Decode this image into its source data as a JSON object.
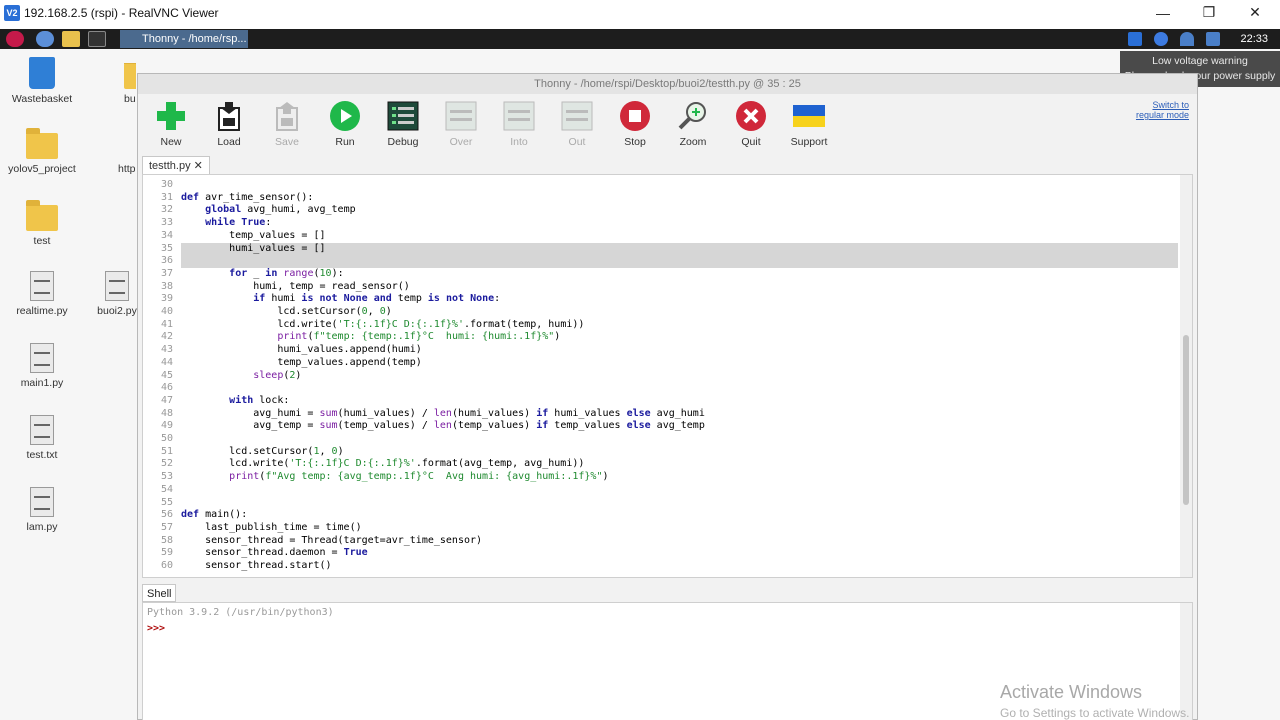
{
  "vnc": {
    "title": "192.168.2.5 (rspi) - RealVNC Viewer",
    "logo_text": "V2"
  },
  "taskbar": {
    "task_label": "Thonny - /home/rsp...",
    "clock": "22:33"
  },
  "warning": {
    "line1": "Low voltage warning",
    "line2": "Please check your power supply"
  },
  "desktop": {
    "items": [
      {
        "label": "Wastebasket",
        "icon": "trash-icon"
      },
      {
        "label": "yolov5_project",
        "icon": "folder-icon"
      },
      {
        "label": "test",
        "icon": "folder-icon"
      },
      {
        "label": "realtime.py",
        "icon": "file-icon"
      },
      {
        "label": "main1.py",
        "icon": "file-icon"
      },
      {
        "label": "test.txt",
        "icon": "file-icon"
      },
      {
        "label": "lam.py",
        "icon": "file-icon"
      },
      {
        "label": "bu",
        "icon": "folder-icon"
      },
      {
        "label": "http",
        "icon": "folder-icon"
      },
      {
        "label": "buoi2.py",
        "icon": "file-icon"
      }
    ]
  },
  "thonny": {
    "title": "Thonny  -  /home/rspi/Desktop/buoi2/testth.py  @  35 : 25",
    "toolbar": [
      {
        "label": "New",
        "icon": "new-icon",
        "enabled": true
      },
      {
        "label": "Load",
        "icon": "load-icon",
        "enabled": true
      },
      {
        "label": "Save",
        "icon": "save-icon",
        "enabled": false
      },
      {
        "label": "Run",
        "icon": "run-icon",
        "enabled": true
      },
      {
        "label": "Debug",
        "icon": "debug-icon",
        "enabled": true
      },
      {
        "label": "Over",
        "icon": "step-over-icon",
        "enabled": false
      },
      {
        "label": "Into",
        "icon": "step-into-icon",
        "enabled": false
      },
      {
        "label": "Out",
        "icon": "step-out-icon",
        "enabled": false
      },
      {
        "label": "Stop",
        "icon": "stop-icon",
        "enabled": true
      },
      {
        "label": "Zoom",
        "icon": "zoom-icon",
        "enabled": true
      },
      {
        "label": "Quit",
        "icon": "quit-icon",
        "enabled": true
      },
      {
        "label": "Support",
        "icon": "ukraine-flag-icon",
        "enabled": true
      }
    ],
    "switch_mode": "Switch to regular mode",
    "file_tab": "testth.py ✕",
    "shell_tab": "Shell",
    "shell_info": "Python 3.9.2 (/usr/bin/python3)",
    "shell_prompt": ">>>"
  },
  "editor": {
    "current_line": 35,
    "lines": [
      {
        "n": "30",
        "t": ""
      },
      {
        "n": "31",
        "t": "def avr_time_sensor():"
      },
      {
        "n": "32",
        "t": "    global avg_humi, avg_temp"
      },
      {
        "n": "33",
        "t": "    while True:"
      },
      {
        "n": "34",
        "t": "        temp_values = []"
      },
      {
        "n": "35",
        "t": "        humi_values = []"
      },
      {
        "n": "36",
        "t": ""
      },
      {
        "n": "37",
        "t": "        for _ in range(10):"
      },
      {
        "n": "38",
        "t": "            humi, temp = read_sensor()"
      },
      {
        "n": "39",
        "t": "            if humi is not None and temp is not None:"
      },
      {
        "n": "40",
        "t": "                lcd.setCursor(0, 0)"
      },
      {
        "n": "41",
        "t": "                lcd.write('T:{:.1f}C D:{:.1f}%'.format(temp, humi))"
      },
      {
        "n": "42",
        "t": "                print(f\"temp: {temp:.1f}°C  humi: {humi:.1f}%\")"
      },
      {
        "n": "43",
        "t": "                humi_values.append(humi)"
      },
      {
        "n": "44",
        "t": "                temp_values.append(temp)"
      },
      {
        "n": "45",
        "t": "            sleep(2)"
      },
      {
        "n": "46",
        "t": ""
      },
      {
        "n": "47",
        "t": "        with lock:"
      },
      {
        "n": "48",
        "t": "            avg_humi = sum(humi_values) / len(humi_values) if humi_values else avg_humi"
      },
      {
        "n": "49",
        "t": "            avg_temp = sum(temp_values) / len(temp_values) if temp_values else avg_temp"
      },
      {
        "n": "50",
        "t": ""
      },
      {
        "n": "51",
        "t": "        lcd.setCursor(1, 0)"
      },
      {
        "n": "52",
        "t": "        lcd.write('T:{:.1f}C D:{:.1f}%'.format(avg_temp, avg_humi))"
      },
      {
        "n": "53",
        "t": "        print(f\"Avg temp: {avg_temp:.1f}°C  Avg humi: {avg_humi:.1f}%\")"
      },
      {
        "n": "54",
        "t": ""
      },
      {
        "n": "55",
        "t": ""
      },
      {
        "n": "56",
        "t": "def main():"
      },
      {
        "n": "57",
        "t": "    last_publish_time = time()"
      },
      {
        "n": "58",
        "t": "    sensor_thread = Thread(target=avr_time_sensor)"
      },
      {
        "n": "59",
        "t": "    sensor_thread.daemon = True"
      },
      {
        "n": "60",
        "t": "    sensor_thread.start()"
      }
    ]
  },
  "watermark": {
    "line1": "Activate Windows",
    "line2": "Go to Settings to activate Windows."
  },
  "colors": {
    "taskbar": "#1d1d1d",
    "keyword": "#1b1b9e",
    "builtin": "#7b1fa2",
    "string": "#1f8a2f",
    "run_green": "#1fb84a",
    "stop_red": "#d0283a"
  }
}
